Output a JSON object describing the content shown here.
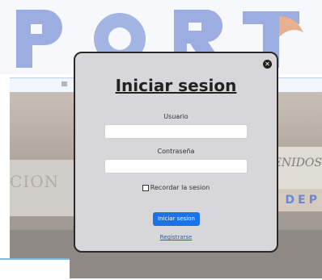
{
  "background": {
    "logo_text": "PORT",
    "building_sign_left": "CION",
    "building_sign_right": "ENIDOS",
    "building_sign_blue": "DEP"
  },
  "login_modal": {
    "title": "Iniciar sesion",
    "username_label": "Usuario",
    "username_value": "",
    "password_label": "Contraseña",
    "password_value": "",
    "remember_label": "Recordar la sesion",
    "remember_checked": false,
    "submit_label": "Iniciar sesion",
    "register_label": "Registrarse",
    "close_icon": "close-icon"
  },
  "colors": {
    "modal_background": "#d7d7da",
    "submit_button": "#1a73e8",
    "register_link": "#2f57b5"
  }
}
